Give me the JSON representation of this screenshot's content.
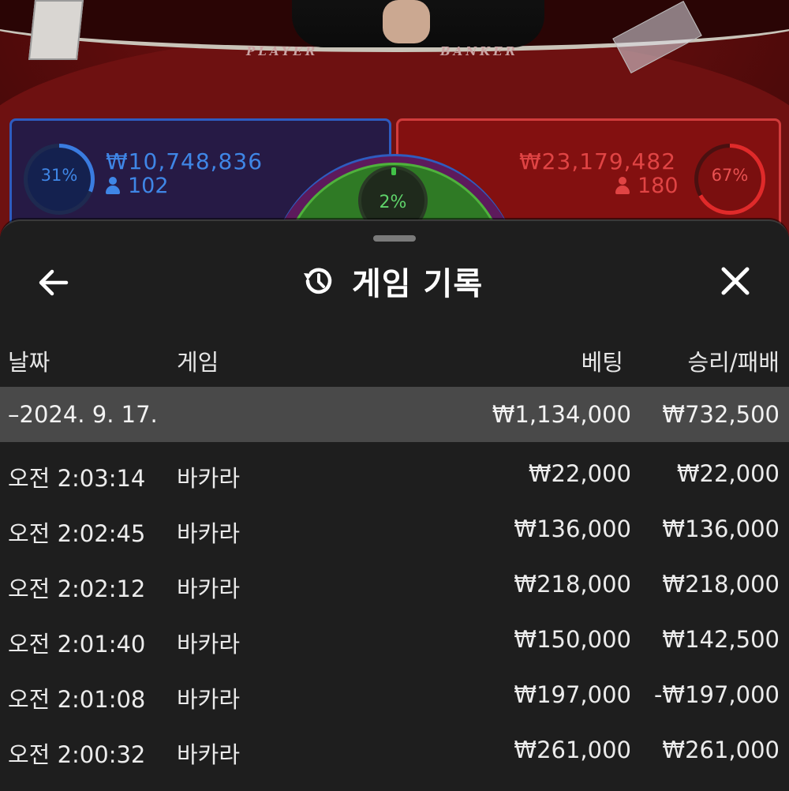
{
  "table": {
    "player_word": "PLAYER",
    "banker_word": "BANKER",
    "player": {
      "percent": "31%",
      "amount": "₩10,748,836",
      "count": "102"
    },
    "banker": {
      "percent": "67%",
      "amount": "₩23,179,482",
      "count": "180"
    },
    "tie": {
      "percent": "2%"
    }
  },
  "header": {
    "title": "게임 기록",
    "back_icon": "arrow-left-icon",
    "history_icon": "history-clock-icon",
    "close_icon": "close-icon"
  },
  "columns": {
    "date": "날짜",
    "game": "게임",
    "bet": "베팅",
    "result": "승리/패배"
  },
  "summary": {
    "date": "–2024. 9. 17.",
    "bet": "₩1,134,000",
    "result": "₩732,500"
  },
  "rows": [
    {
      "time": "오전 2:03:14",
      "game": "바카라",
      "bet": "₩22,000",
      "result": "₩22,000"
    },
    {
      "time": "오전 2:02:45",
      "game": "바카라",
      "bet": "₩136,000",
      "result": "₩136,000"
    },
    {
      "time": "오전 2:02:12",
      "game": "바카라",
      "bet": "₩218,000",
      "result": "₩218,000"
    },
    {
      "time": "오전 2:01:40",
      "game": "바카라",
      "bet": "₩150,000",
      "result": "₩142,500"
    },
    {
      "time": "오전 2:01:08",
      "game": "바카라",
      "bet": "₩197,000",
      "result": "-₩197,000"
    },
    {
      "time": "오전 2:00:32",
      "game": "바카라",
      "bet": "₩261,000",
      "result": "₩261,000"
    }
  ]
}
